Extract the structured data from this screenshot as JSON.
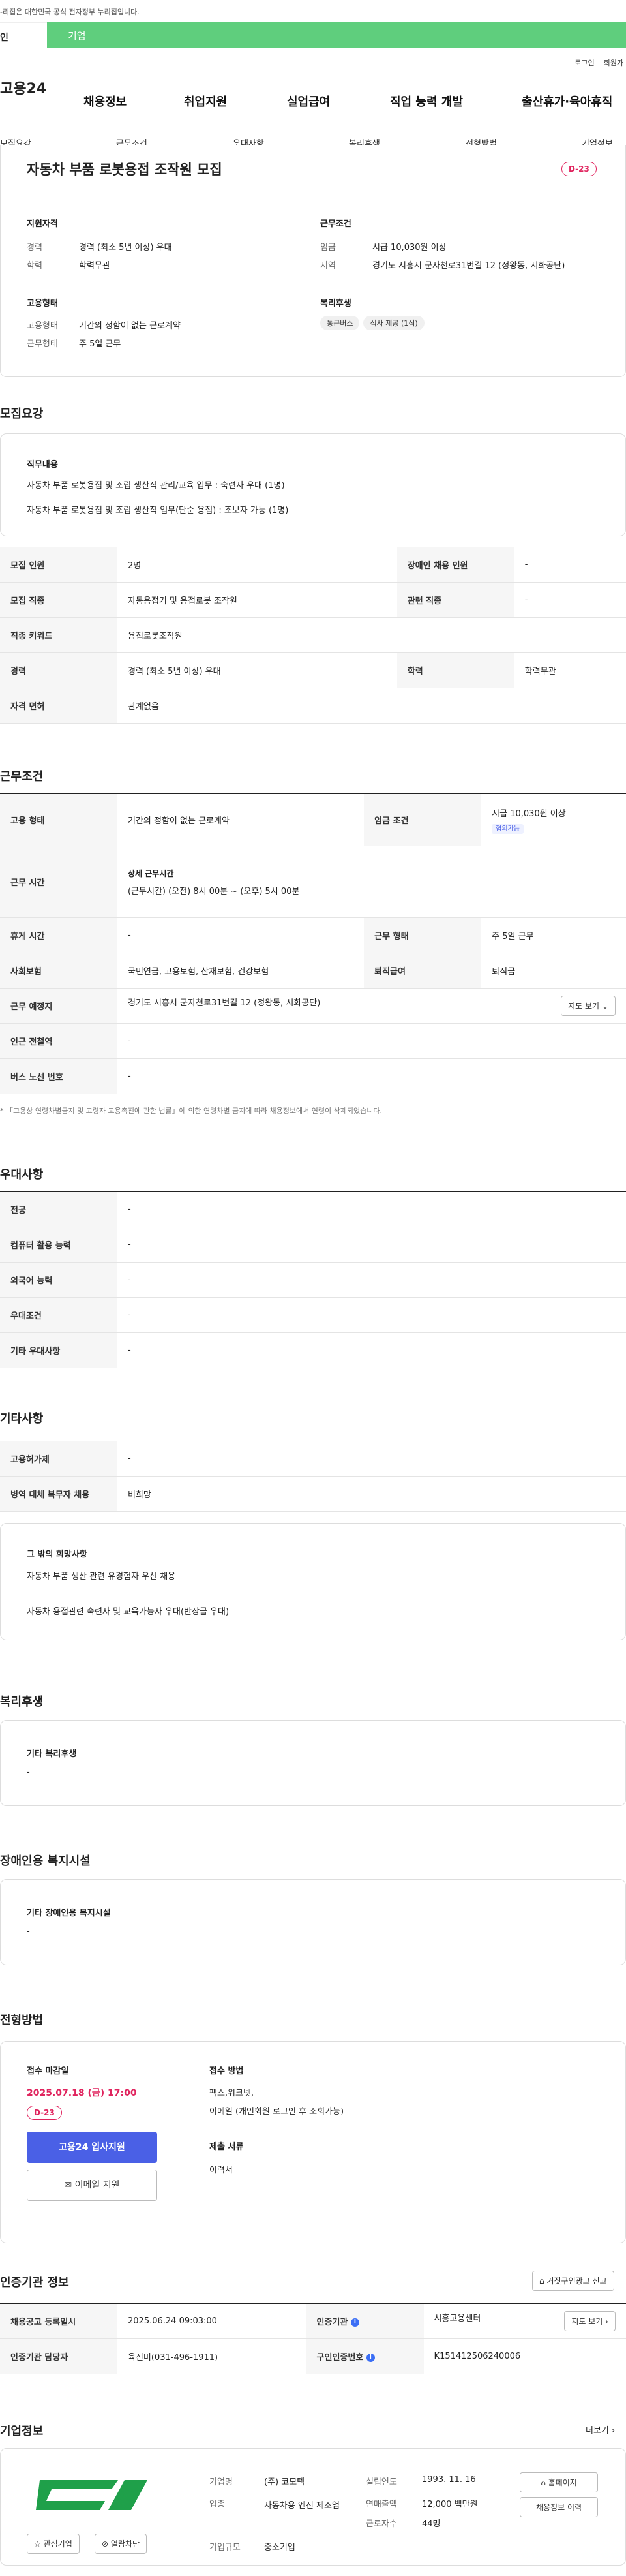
{
  "topnote": "-리집은 대한민국 공식 전자정부 누리집입니다.",
  "tabs": [
    "인",
    "기업"
  ],
  "util": [
    "로그인",
    "회원가"
  ],
  "gnb": {
    "logo": "고용24",
    "items": [
      "채용정보",
      "취업지원",
      "실업급여",
      "직업 능력 개발",
      "출산휴가·육아휴직"
    ]
  },
  "lnb": [
    "모집요강",
    "근무조건",
    "우대사항",
    "복리후생",
    "전형방법",
    "기업정보"
  ],
  "title": "자동차 부품 로봇용접 조작원 모집",
  "dday": "D-23",
  "summary": {
    "qual_head": "지원자격",
    "career_l": "경력",
    "career_v": "경력 (최소 5년 이상) 우대",
    "edu_l": "학력",
    "edu_v": "학력무관",
    "work_head": "근무조건",
    "wage_l": "임금",
    "wage_v": "시급 10,030원 이상",
    "area_l": "지역",
    "area_v": "경기도 시흥시 군자천로31번길 12 (정왕동, 시화공단)",
    "emp_head": "고용형태",
    "etype_l": "고용형태",
    "etype_v": "기간의 정함이 없는 근로계약",
    "wtype_l": "근무형태",
    "wtype_v": "주 5일 근무",
    "welf_head": "복리후생",
    "welf_tags": [
      "통근버스",
      "식사 제공 (1식)"
    ]
  },
  "recruit": {
    "head": "모집요강",
    "job_head": "직무내용",
    "job_lines": [
      "자동차 부품 로봇용접 및 조립 생산직 관리/교육 업무 : 숙련자 우대  (1명)",
      "자동차 부품 로봇용접 및 조립 생산직 업무(단순 용접) : 조보자 가능 (1명)"
    ],
    "rows": [
      [
        "모집 인원",
        "2명",
        "장애인 채용 인원",
        "-"
      ],
      [
        "모집 직종",
        "자동용접기 및 용접로봇 조작원",
        "관련 직종",
        "-"
      ],
      [
        "직종 키워드",
        "용접로봇조작원"
      ],
      [
        "경력",
        "경력 (최소 5년 이상) 우대",
        "학력",
        "학력무관"
      ],
      [
        "자격 면허",
        "관계없음"
      ]
    ]
  },
  "work": {
    "head": "근무조건",
    "etype_l": "고용 형태",
    "etype_v": "기간의 정함이 없는 근로계약",
    "wage_l": "임금 조건",
    "wage_v": "시급 10,030원 이상",
    "wage_tag": "협의가능",
    "time_l": "근무 시간",
    "time_head": "상세 근무시간",
    "time_v": "(근무시간) (오전) 8시 00분 ~ (오후) 5시 00분",
    "rest_l": "휴게 시간",
    "rest_v": "-",
    "wtype_l": "근무 형태",
    "wtype_v": "주 5일 근무",
    "ins_l": "사회보험",
    "ins_v": "국민연금, 고용보험, 산재보험, 건강보험",
    "sev_l": "퇴직급여",
    "sev_v": "퇴직금",
    "place_l": "근무 예정지",
    "place_v": "경기도 시흥시 군자천로31번길 12 (정왕동, 시화공단)",
    "map_btn": "지도 보기",
    "subway_l": "인근 전철역",
    "subway_v": "-",
    "bus_l": "버스 노선 번호",
    "bus_v": "-",
    "note": "* 「고용상 연령차별금지 및 고령자 고용촉진에 관한 법률」에 의한 연령차별 금지에 따라 채용정보에서 연령이 삭제되었습니다."
  },
  "pref": {
    "head": "우대사항",
    "rows": [
      [
        "전공",
        "-"
      ],
      [
        "컴퓨터 활용 능력",
        "-"
      ],
      [
        "외국어 능력",
        "-"
      ],
      [
        "우대조건",
        "-"
      ],
      [
        "기타 우대사항",
        "-"
      ]
    ]
  },
  "etc": {
    "head": "기타사항",
    "rows": [
      [
        "고용허가제",
        "-"
      ],
      [
        "병역 대체 복무자 채용",
        "비희망"
      ]
    ],
    "wish_head": "그 밖의 희망사항",
    "wish_lines": [
      "자동차 부품 생산 관련 유경험자 우선 채용",
      "자동차 용접관련 숙련자 및 교육가능자 우대(반장급 우대)"
    ]
  },
  "welfare": {
    "head": "복리후생",
    "sub": "기타 복리후생",
    "val": "-"
  },
  "disab": {
    "head": "장애인용 복지시설",
    "sub": "기타 장애인용 복지시설",
    "val": "-"
  },
  "select": {
    "head": "전형방법",
    "deadline_l": "접수 마감일",
    "deadline_v": "2025.07.18 (금) 17:00",
    "dday": "D-23",
    "apply_btn": "고용24 입사지원",
    "email_btn": "이메일 지원",
    "method_l": "접수 방법",
    "method_lines": [
      "팩스,워크넷,",
      "이메일 (개인회원 로그인 후 조회가능)"
    ],
    "docs_l": "제출 서류",
    "docs_v": "이력서"
  },
  "agency": {
    "head": "인증기관 정보",
    "report_btn": "거짓구인광고 신고",
    "rows": [
      [
        "채용공고 등록일시",
        "2025.06.24 09:03:00",
        "인증기관",
        "시흥고용센터"
      ],
      [
        "인증기관 담당자",
        "육진미(031-496-1911)",
        "구인인증번호",
        "K151412506240006"
      ]
    ],
    "map_btn": "지도 보기"
  },
  "company": {
    "head": "기업정보",
    "more": "더보기",
    "interest_btn": "관심기업",
    "block_btn": "열람차단",
    "name_l": "기업명",
    "name_v": "(주) 코모텍",
    "ind_l": "업종",
    "ind_v": "자동차용 엔진 제조업",
    "size_l": "기업규모",
    "size_v": "중소기업",
    "found_l": "설립연도",
    "found_v": "1993. 11. 16",
    "sales_l": "연매출액",
    "sales_v": "12,000 백만원",
    "emp_l": "근로자수",
    "emp_v": "44명",
    "home_btn": "홈페이지",
    "hist_btn": "채용정보 이력"
  },
  "colors": {
    "green": "#5fce7d",
    "blue": "#4a60e6",
    "red": "#e0245e",
    "logo_green": "#1fa04a"
  }
}
